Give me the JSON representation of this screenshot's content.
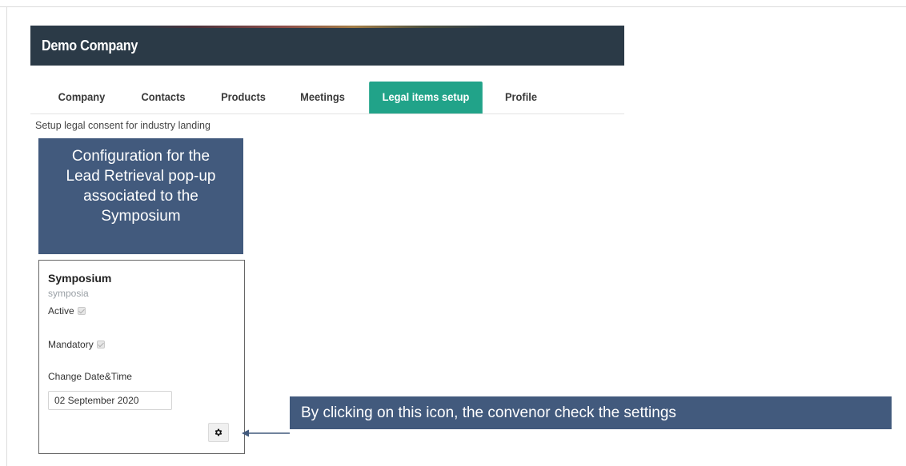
{
  "app": {
    "title": "Demo Company"
  },
  "tabs": [
    {
      "label": "Company",
      "active": false
    },
    {
      "label": "Contacts",
      "active": false
    },
    {
      "label": "Products",
      "active": false
    },
    {
      "label": "Meetings",
      "active": false
    },
    {
      "label": "Legal items setup",
      "active": true
    },
    {
      "label": "Profile",
      "active": false
    }
  ],
  "page": {
    "subtitle": "Setup legal consent for industry landing"
  },
  "callouts": {
    "top": [
      "Configuration for the",
      "Lead Retrieval pop-up",
      "associated to the",
      "Symposium"
    ],
    "right": "By clicking on this icon, the convenor check the settings"
  },
  "card": {
    "title": "Symposium",
    "subtitle": "symposia",
    "active_label": "Active",
    "active_checked": true,
    "mandatory_label": "Mandatory",
    "mandatory_checked": true,
    "date_label": "Change Date&Time",
    "date_value": "02 September 2020",
    "settings_icon": "gear-icon"
  },
  "colors": {
    "header_bg": "#2b3a47",
    "tab_active": "#21a389",
    "callout_bg": "#425a7d"
  }
}
